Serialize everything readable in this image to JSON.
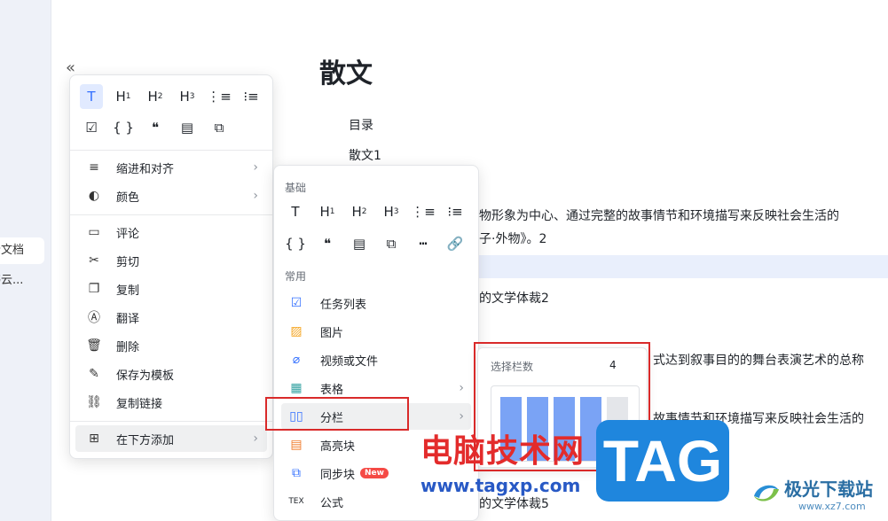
{
  "sidebar": {
    "items": [
      {
        "label": "云文档"
      },
      {
        "label": "书云..."
      }
    ]
  },
  "document": {
    "title": "散文",
    "toc": [
      "目录",
      "散文1"
    ],
    "lines": [
      "物形象为中心、通过完整的故事情节和环境描写来反映社会生活的",
      "子·外物》。2",
      "的文学体裁2",
      "式达到叙事目的的舞台表演艺术的总称",
      "故事情节和环境描写来反映社会生活的",
      "的文学体裁5"
    ]
  },
  "collapse_icon": "«",
  "menu1": {
    "icon_row1": [
      {
        "name": "text-icon",
        "glyph": "T"
      },
      {
        "name": "heading1-icon",
        "glyph": "H",
        "sub": "1"
      },
      {
        "name": "heading2-icon",
        "glyph": "H",
        "sub": "2"
      },
      {
        "name": "heading3-icon",
        "glyph": "H",
        "sub": "3"
      },
      {
        "name": "ordered-list-icon",
        "glyph": "⋮≡"
      },
      {
        "name": "bullet-list-icon",
        "glyph": "⁝≡"
      }
    ],
    "icon_row2": [
      {
        "name": "checkbox-icon",
        "glyph": "☑"
      },
      {
        "name": "code-block-icon",
        "glyph": "{ }"
      },
      {
        "name": "quote-icon",
        "glyph": "❝"
      },
      {
        "name": "highlight-block-icon",
        "glyph": "▤"
      },
      {
        "name": "sync-block-icon",
        "glyph": "⧉"
      }
    ],
    "items": [
      {
        "label": "缩进和对齐",
        "icon": "align-left-icon",
        "glyph": "≡",
        "submenu": true
      },
      {
        "label": "颜色",
        "icon": "palette-icon",
        "glyph": "◐",
        "submenu": true
      },
      {
        "label": "评论",
        "icon": "comment-icon",
        "glyph": "▭"
      },
      {
        "label": "剪切",
        "icon": "scissors-icon",
        "glyph": "✂"
      },
      {
        "label": "复制",
        "icon": "copy-icon",
        "glyph": "❐"
      },
      {
        "label": "翻译",
        "icon": "translate-icon",
        "glyph": "Ⓐ"
      },
      {
        "label": "删除",
        "icon": "trash-icon",
        "glyph": "🗑"
      },
      {
        "label": "保存为模板",
        "icon": "template-icon",
        "glyph": "✎"
      },
      {
        "label": "复制链接",
        "icon": "link-icon",
        "glyph": "⛓"
      },
      {
        "label": "在下方添加",
        "icon": "add-below-icon",
        "glyph": "⊞",
        "submenu": true
      }
    ]
  },
  "menu2": {
    "section_basic": "基础",
    "section_common": "常用",
    "icon_row1": [
      {
        "name": "text-icon",
        "glyph": "T"
      },
      {
        "name": "heading1-icon",
        "glyph": "H",
        "sub": "1"
      },
      {
        "name": "heading2-icon",
        "glyph": "H",
        "sub": "2"
      },
      {
        "name": "heading3-icon",
        "glyph": "H",
        "sub": "3"
      },
      {
        "name": "ordered-list-icon",
        "glyph": "⋮≡"
      },
      {
        "name": "bullet-list-icon",
        "glyph": "⁝≡"
      }
    ],
    "icon_row2": [
      {
        "name": "code-block-icon",
        "glyph": "{ }"
      },
      {
        "name": "quote-icon",
        "glyph": "❝"
      },
      {
        "name": "highlight-block-icon",
        "glyph": "▤"
      },
      {
        "name": "sync-block-icon",
        "glyph": "⧉"
      },
      {
        "name": "divider-icon",
        "glyph": "┅"
      },
      {
        "name": "link-icon",
        "glyph": "🔗"
      }
    ],
    "items": [
      {
        "label": "任务列表",
        "icon": "checkbox-icon",
        "glyph": "☑",
        "color": "#3370ff"
      },
      {
        "label": "图片",
        "icon": "image-icon",
        "glyph": "▨",
        "color": "#f5a623"
      },
      {
        "label": "视频或文件",
        "icon": "attachment-icon",
        "glyph": "⌀",
        "color": "#3370ff"
      },
      {
        "label": "表格",
        "icon": "table-icon",
        "glyph": "▦",
        "color": "#34a2a2",
        "submenu": true
      },
      {
        "label": "分栏",
        "icon": "columns-icon",
        "glyph": "▯▯",
        "color": "#3370ff",
        "submenu": true
      },
      {
        "label": "高亮块",
        "icon": "highlight-icon",
        "glyph": "▤",
        "color": "#f07c2c"
      },
      {
        "label": "同步块",
        "icon": "sync-icon",
        "glyph": "⧉",
        "color": "#3370ff",
        "badge": "New"
      },
      {
        "label": "公式",
        "icon": "formula-icon",
        "glyph": "TEX",
        "color": "#333333"
      }
    ]
  },
  "column_picker": {
    "label": "选择栏数",
    "count": "4",
    "selected": 4,
    "max": 5
  },
  "watermarks": {
    "site_name": "电脑技术网",
    "site_url": "www.tagxp.com",
    "tag": "TAG",
    "logo_text": "极光下载站",
    "logo_url": "www.xz7.com"
  },
  "colors": {
    "accent": "#3370ff",
    "highlight_row": "#e9effc",
    "red_box": "#d92a2a",
    "column_on": "#7aa3f5"
  }
}
